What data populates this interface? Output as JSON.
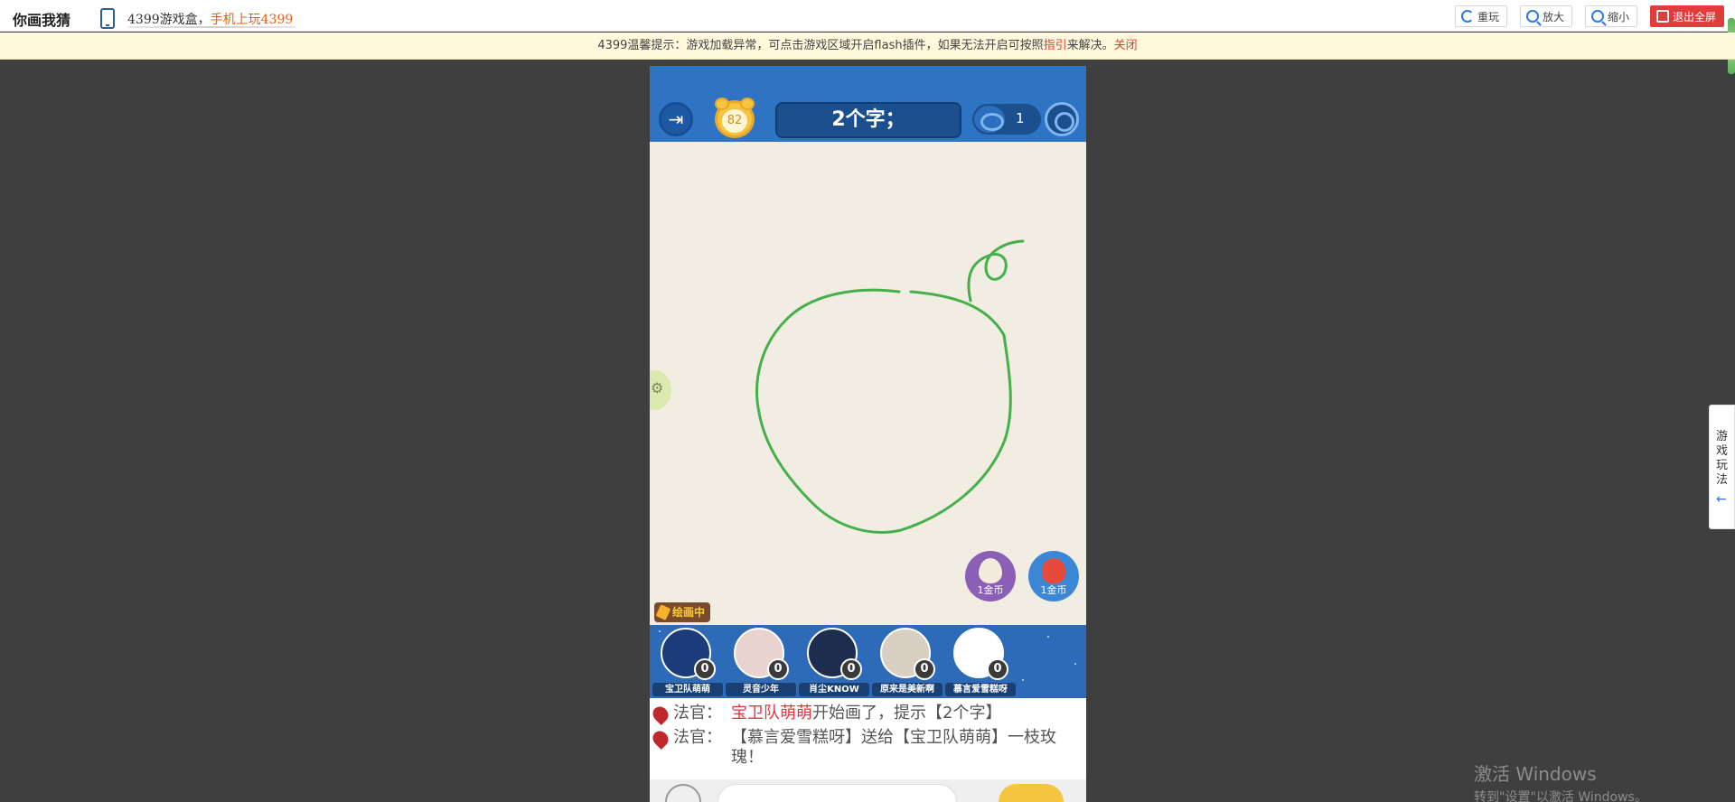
{
  "topbar": {
    "title": "你画我猜",
    "promo_prefix": "4399游戏盒，",
    "promo_highlight": "手机上玩4399",
    "buttons": {
      "replay": "重玩",
      "zoom_in": "放大",
      "zoom_out": "缩小",
      "exit_fullscreen": "退出全屏"
    }
  },
  "notice": {
    "text_before": "4399温馨提示：游戏加载异常，可点击游戏区域开启flash插件，如果无法开启可按照",
    "link_guide": "指引",
    "text_after": "来解决。",
    "close": "关闭"
  },
  "game": {
    "timer": "82",
    "hint": "2个字；",
    "viewers": "1",
    "gifts": [
      {
        "name": "egg",
        "cost": "1金币"
      },
      {
        "name": "rose",
        "cost": "1金币"
      }
    ],
    "drawing_status": "绘画中",
    "players": [
      {
        "name": "宝卫队萌萌",
        "score": "0",
        "avatar_color": "#1b3b7a"
      },
      {
        "name": "灵音少年",
        "score": "0",
        "avatar_color": "#e9d3cf"
      },
      {
        "name": "肖尘KNOW",
        "score": "0",
        "avatar_color": "#1d2d4f"
      },
      {
        "name": "原来是美新啊",
        "score": "0",
        "avatar_color": "#d8cfc2"
      },
      {
        "name": "慕言爱雪糕呀",
        "score": "0",
        "avatar_color": "#ffffff"
      }
    ],
    "chat": [
      {
        "who": "法官：",
        "highlight": "宝卫队萌萌",
        "text": "开始画了，提示【2个字】"
      },
      {
        "who": "法官：",
        "highlight": "",
        "text": "【慕言爱雪糕呀】送给【宝卫队萌萌】一枝玫瑰！"
      }
    ],
    "stroke_color": "#45b04a"
  },
  "side_tab": {
    "label": "游戏玩法",
    "arrow": "←"
  },
  "watermark": {
    "line1": "激活 Windows",
    "line2": "转到\"设置\"以激活 Windows。"
  }
}
